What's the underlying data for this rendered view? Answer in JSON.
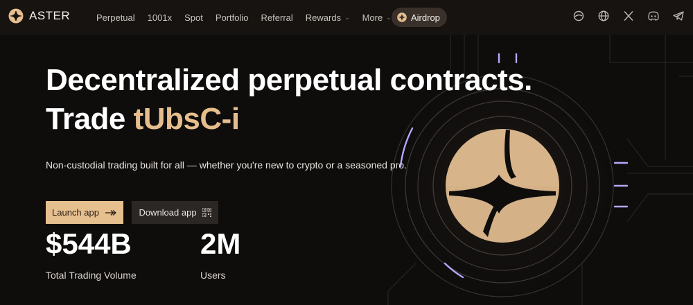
{
  "nav": {
    "brand": "ASTER",
    "items": [
      {
        "label": "Perpetual",
        "dropdown": false
      },
      {
        "label": "1001x",
        "dropdown": false
      },
      {
        "label": "Spot",
        "dropdown": false
      },
      {
        "label": "Portfolio",
        "dropdown": false
      },
      {
        "label": "Referral",
        "dropdown": false
      },
      {
        "label": "Rewards",
        "dropdown": true
      },
      {
        "label": "More",
        "dropdown": true
      }
    ],
    "airdrop_label": "Airdrop",
    "social_icons": [
      "gitbook-icon",
      "globe-icon",
      "x-icon",
      "discord-icon",
      "telegram-icon"
    ]
  },
  "hero": {
    "title_line1": "Decentralized perpetual contracts.",
    "title_line2_prefix": "Trade",
    "title_line2_accent": "tUbsC-i",
    "subtitle": "Non-custodial trading built for all — whether you're new to crypto or a seasoned pro."
  },
  "buttons": {
    "launch_label": "Launch app",
    "download_label": "Download app"
  },
  "stats": [
    {
      "value": "$544B",
      "label": "Total Trading Volume"
    },
    {
      "value": "2M",
      "label": "Users"
    }
  ],
  "colors": {
    "background": "#0f0d0c",
    "accent": "#e6be8d",
    "glow": "#9c8cf0"
  }
}
